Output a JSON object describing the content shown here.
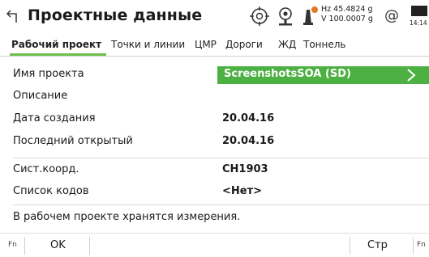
{
  "header": {
    "title": "Проектные данные",
    "back_icon": "back-arrow-icon",
    "hz_line": "Hz 45.4824 g",
    "v_line": "V  100.0007 g",
    "at_symbol": "@",
    "time": "14:14",
    "accent_color": "#e07a1f"
  },
  "tabs": [
    {
      "label": "Рабочий проект",
      "active": true
    },
    {
      "label": "Точки и линии"
    },
    {
      "label": "ЦМР"
    },
    {
      "label": "Дороги"
    },
    {
      "label": "ЖД"
    },
    {
      "label": "Тоннель"
    }
  ],
  "fields": {
    "project_name": {
      "label": "Имя проекта",
      "value": "ScreenshotsSOA (SD)"
    },
    "description": {
      "label": "Описание",
      "value": ""
    },
    "created": {
      "label": "Дата создания",
      "value": "20.04.16"
    },
    "last_opened": {
      "label": "Последний открытый",
      "value": "20.04.16"
    },
    "coord_system": {
      "label": "Сист.коорд.",
      "value": "CH1903"
    },
    "code_list": {
      "label": "Список кодов",
      "value": "<Нет>"
    }
  },
  "message": "В рабочем проекте хранятся измерения.",
  "softkeys": {
    "fn_left": "Fn",
    "ok": "OK",
    "page": "Стр",
    "fn_right": "Fn"
  },
  "colors": {
    "green_bar": "#4db043",
    "tab_underline": "#6cc04a"
  }
}
